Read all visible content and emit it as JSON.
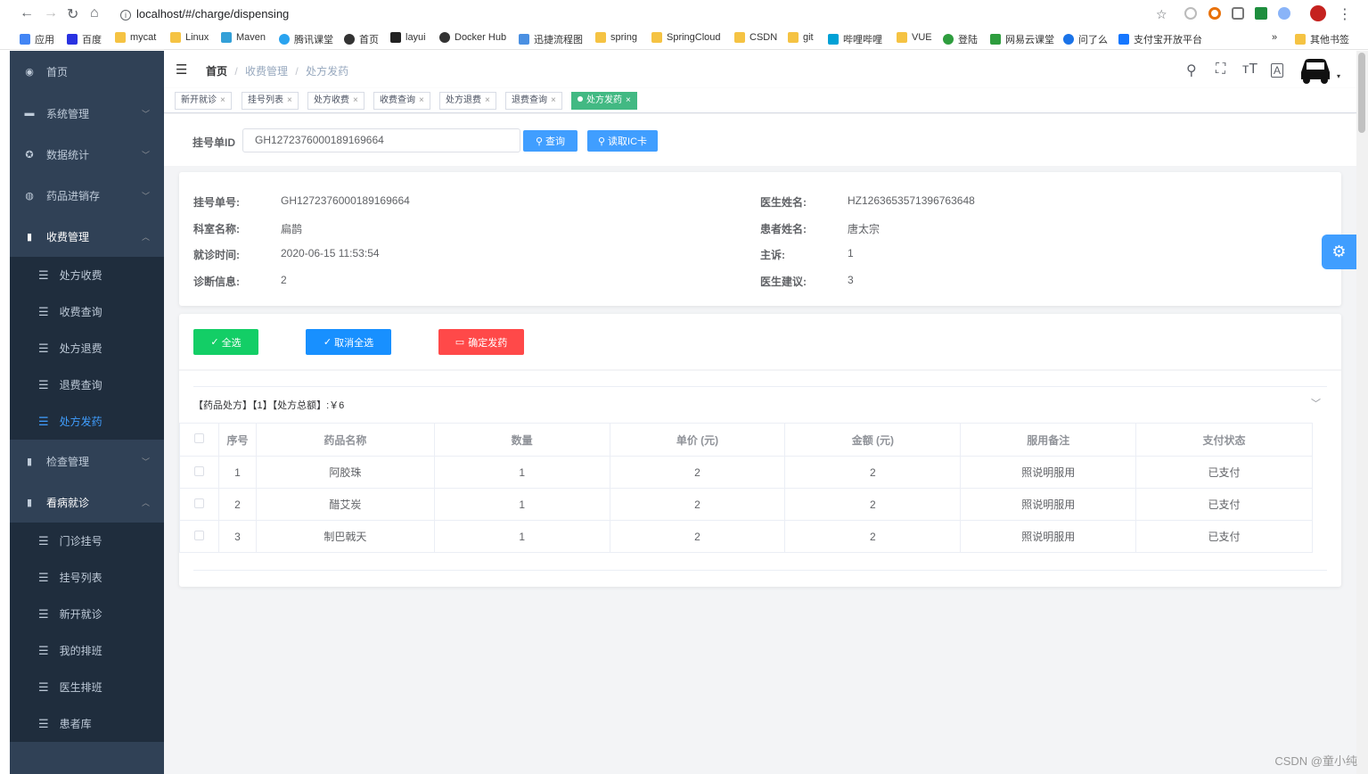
{
  "browser": {
    "url": "localhost/#/charge/dispensing",
    "bookmarks": [
      "应用",
      "百度",
      "mycat",
      "Linux",
      "Maven",
      "腾讯课堂",
      "首页",
      "layui",
      "Docker Hub",
      "迅捷流程图",
      "spring",
      "SpringCloud",
      "CSDN",
      "git",
      "哔哩哔哩",
      "VUE",
      "登陆",
      "网易云课堂",
      "问了么",
      "支付宝开放平台"
    ],
    "more_label": "»",
    "other_bookmarks": "其他书签"
  },
  "sidebar": {
    "items": [
      {
        "label": "首页",
        "icon": "dashboard-icon"
      },
      {
        "label": "系统管理",
        "icon": "lock-icon"
      },
      {
        "label": "数据统计",
        "icon": "chart-icon"
      },
      {
        "label": "药品进销存",
        "icon": "drug-icon"
      },
      {
        "label": "收费管理",
        "icon": "fee-icon"
      }
    ],
    "charge_subitems": [
      "处方收费",
      "收费查询",
      "处方退费",
      "退费查询",
      "处方发药"
    ],
    "exam_label": "检查管理",
    "visit_label": "看病就诊",
    "visit_subitems": [
      "门诊挂号",
      "挂号列表",
      "新开就诊",
      "我的排班",
      "医生排班",
      "患者库"
    ]
  },
  "breadcrumb": [
    "首页",
    "收费管理",
    "处方发药"
  ],
  "tags": [
    "新开就诊",
    "挂号列表",
    "处方收费",
    "收费查询",
    "处方退费",
    "退费查询",
    "处方发药"
  ],
  "search": {
    "label": "挂号单ID",
    "value": "GH1272376000189169664",
    "query_button": "查询",
    "ic_button": "读取IC卡"
  },
  "info": {
    "reg_no_label": "挂号单号:",
    "reg_no": "GH1272376000189169664",
    "dept_label": "科室名称:",
    "dept": "扁鹊",
    "time_label": "就诊时间:",
    "time": "2020-06-15 11:53:54",
    "diag_label": "诊断信息:",
    "diag": "2",
    "doctor_label": "医生姓名:",
    "doctor": "HZ1263653571396763648",
    "patient_label": "患者姓名:",
    "patient": "唐太宗",
    "complaint_label": "主诉:",
    "complaint": "1",
    "advice_label": "医生建议:",
    "advice": "3"
  },
  "actions": {
    "select_all": "全选",
    "cancel_select": "取消全选",
    "confirm": "确定发药",
    "select_all_color": "#13ce66",
    "cancel_color": "#1890ff",
    "confirm_color": "#ff4949"
  },
  "prescription_title": "【药品处方】【1】【处方总额】:￥6",
  "table": {
    "headers": [
      "序号",
      "药品名称",
      "数量",
      "单价 (元)",
      "金额 (元)",
      "服用备注",
      "支付状态"
    ],
    "rows": [
      [
        "1",
        "阿胶珠",
        "1",
        "2",
        "2",
        "照说明服用",
        "已支付"
      ],
      [
        "2",
        "醋艾炭",
        "1",
        "2",
        "2",
        "照说明服用",
        "已支付"
      ],
      [
        "3",
        "制巴戟天",
        "1",
        "2",
        "2",
        "照说明服用",
        "已支付"
      ]
    ]
  },
  "watermark": "CSDN @童小纯"
}
